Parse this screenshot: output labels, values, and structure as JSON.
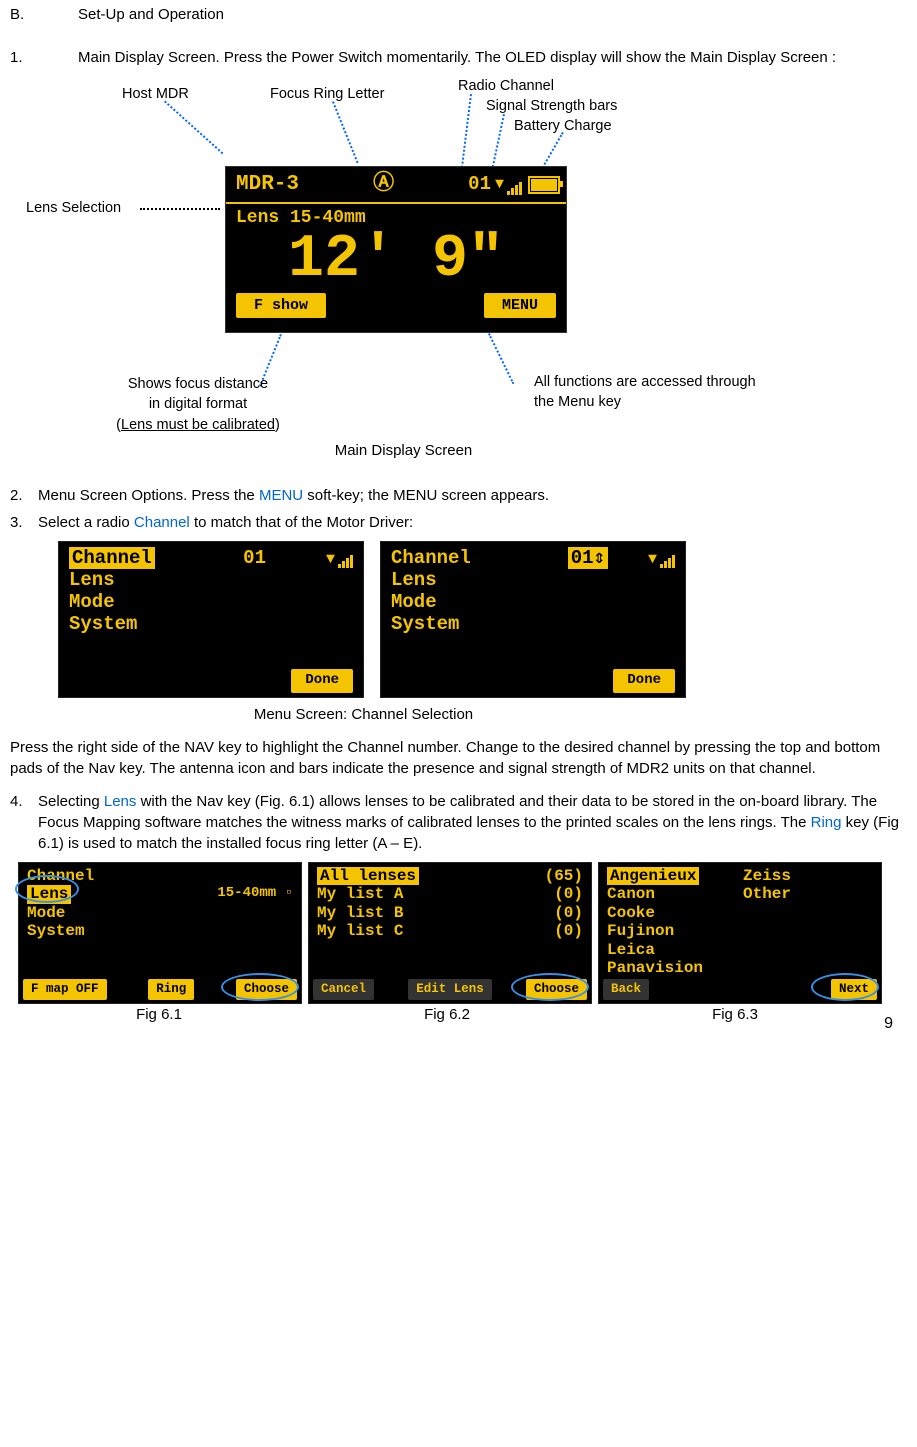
{
  "section": {
    "letter": "B.",
    "title": "Set-Up and Operation"
  },
  "step1": {
    "num": "1.",
    "text": "Main Display Screen. Press the Power Switch momentarily. The OLED display will show the Main Display Screen :"
  },
  "callouts": {
    "host_mdr": "Host MDR",
    "focus_ring_letter": "Focus Ring Letter",
    "radio_channel": "Radio Channel",
    "signal_strength": "Signal Strength bars",
    "battery_charge": "Battery Charge",
    "lens_selection": "Lens Selection",
    "shows_focus_l1": "Shows focus distance",
    "shows_focus_l2": "in digital format",
    "shows_focus_l3_pre": "(",
    "shows_focus_l3_u": "Lens must be calibrated",
    "shows_focus_l3_post": ")",
    "all_functions_l1": "All functions are accessed through",
    "all_functions_l2": "the Menu key",
    "main_display_caption": "Main Display Screen"
  },
  "oled_main": {
    "host": "MDR-3",
    "ring_letter": "Ⓐ",
    "channel": "01",
    "lens_line": "Lens  15-40mm",
    "focus": "12' 9\"",
    "soft_left": "F show",
    "soft_right": "MENU"
  },
  "step2": {
    "num": "2.",
    "pre": "Menu Screen Options. Press the ",
    "link": "MENU",
    "post": " soft-key; the MENU screen appears."
  },
  "step3": {
    "num": "3.",
    "pre": "Select a radio ",
    "link": "Channel",
    "post": " to match that of the Motor Driver:"
  },
  "menu_caption": "Menu Screen: Channel Selection",
  "menu_screen_a": {
    "items": [
      {
        "label": "Channel",
        "value": "01"
      },
      {
        "label": "Lens",
        "value": ""
      },
      {
        "label": "Mode",
        "value": ""
      },
      {
        "label": "System",
        "value": ""
      }
    ],
    "soft": "Done"
  },
  "menu_screen_b": {
    "items": [
      {
        "label": "Channel",
        "value": "01⇕"
      },
      {
        "label": "Lens",
        "value": ""
      },
      {
        "label": "Mode",
        "value": ""
      },
      {
        "label": "System",
        "value": ""
      }
    ],
    "soft": "Done"
  },
  "para_nav": "Press the right side of the NAV key to highlight the Channel number. Change to the desired channel by pressing the top and bottom pads of the Nav key. The antenna icon and bars indicate the presence and signal strength of MDR2 units on that channel.",
  "step4": {
    "num": "4.",
    "pre": "Selecting ",
    "link1": "Lens",
    "mid": " with the Nav key (Fig. 6.1) allows lenses to be calibrated and their data to be stored in the on-board library. The Focus Mapping software matches the witness marks of calibrated lenses to the printed scales on the lens rings. The ",
    "link2": "Ring",
    "post": " key (Fig 6.1) is used to match the installed focus ring letter (A – E)."
  },
  "fig61": {
    "items": [
      {
        "label": "Channel",
        "value": ""
      },
      {
        "label": "Lens",
        "value": "15-40mm      ▫"
      },
      {
        "label": "Mode",
        "value": ""
      },
      {
        "label": "System",
        "value": ""
      }
    ],
    "soft_left": "F map OFF",
    "soft_mid": "Ring",
    "soft_right": "Choose"
  },
  "fig62": {
    "items": [
      {
        "label": "All lenses",
        "value": "(65)"
      },
      {
        "label": "My list A",
        "value": "(0)"
      },
      {
        "label": "My list B",
        "value": "(0)"
      },
      {
        "label": "My list C",
        "value": "(0)"
      }
    ],
    "soft_left": "Cancel",
    "soft_mid": "Edit Lens",
    "soft_right": "Choose"
  },
  "fig63": {
    "col1": [
      "Angenieux",
      "Canon",
      "Cooke",
      "Fujinon",
      "Leica",
      "Panavision"
    ],
    "col2": [
      "Zeiss",
      "Other"
    ],
    "soft_left": "Back",
    "soft_right": "Next"
  },
  "fig_captions": {
    "a": "Fig 6.1",
    "b": "Fig 6.2",
    "c": "Fig 6.3"
  },
  "page_number": "9"
}
